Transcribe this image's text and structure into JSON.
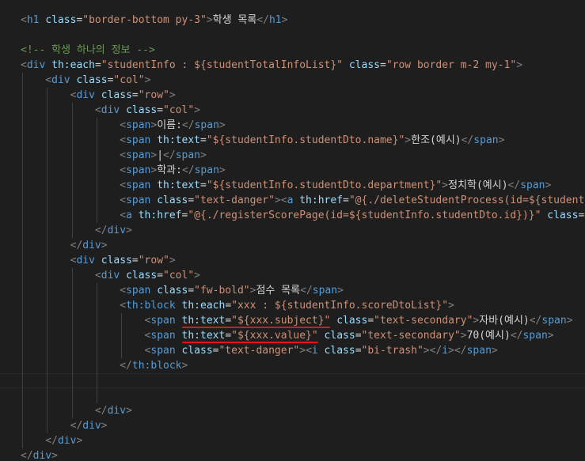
{
  "editor": {
    "theme": {
      "background": "#1e1e1e",
      "tag": "#569cd6",
      "attribute": "#9cdcfe",
      "string": "#ce9178",
      "text": "#d4d4d4",
      "bracket": "#808080",
      "comment": "#6a9955",
      "error_underline": "#e51414"
    },
    "lines": [
      [
        [
          "b",
          "<"
        ],
        [
          "t",
          "h1"
        ],
        [
          "p",
          " "
        ],
        [
          "a",
          "class"
        ],
        [
          "p",
          "="
        ],
        [
          "s",
          "\"border-bottom py-3\""
        ],
        [
          "b",
          ">"
        ],
        [
          "x",
          "학생 목록"
        ],
        [
          "b",
          "</"
        ],
        [
          "t",
          "h1"
        ],
        [
          "b",
          ">"
        ]
      ],
      [],
      [
        [
          "c",
          "<!-- 학생 하나의 정보 -->"
        ]
      ],
      [
        [
          "b",
          "<"
        ],
        [
          "t",
          "div"
        ],
        [
          "p",
          " "
        ],
        [
          "a",
          "th:each"
        ],
        [
          "p",
          "="
        ],
        [
          "s",
          "\"studentInfo : ${studentTotalInfoList}\""
        ],
        [
          "p",
          " "
        ],
        [
          "a",
          "class"
        ],
        [
          "p",
          "="
        ],
        [
          "s",
          "\"row border m-2 my-1\""
        ],
        [
          "b",
          ">"
        ]
      ],
      [
        [
          "p",
          "    "
        ],
        [
          "b",
          "<"
        ],
        [
          "t",
          "div"
        ],
        [
          "p",
          " "
        ],
        [
          "a",
          "class"
        ],
        [
          "p",
          "="
        ],
        [
          "s",
          "\"col\""
        ],
        [
          "b",
          ">"
        ]
      ],
      [
        [
          "p",
          "        "
        ],
        [
          "b",
          "<"
        ],
        [
          "t",
          "div"
        ],
        [
          "p",
          " "
        ],
        [
          "a",
          "class"
        ],
        [
          "p",
          "="
        ],
        [
          "s",
          "\"row\""
        ],
        [
          "b",
          ">"
        ]
      ],
      [
        [
          "p",
          "            "
        ],
        [
          "b",
          "<"
        ],
        [
          "t",
          "div"
        ],
        [
          "p",
          " "
        ],
        [
          "a",
          "class"
        ],
        [
          "p",
          "="
        ],
        [
          "s",
          "\"col\""
        ],
        [
          "b",
          ">"
        ]
      ],
      [
        [
          "p",
          "                "
        ],
        [
          "b",
          "<"
        ],
        [
          "t",
          "span"
        ],
        [
          "b",
          ">"
        ],
        [
          "x",
          "이름:"
        ],
        [
          "b",
          "</"
        ],
        [
          "t",
          "span"
        ],
        [
          "b",
          ">"
        ]
      ],
      [
        [
          "p",
          "                "
        ],
        [
          "b",
          "<"
        ],
        [
          "t",
          "span"
        ],
        [
          "p",
          " "
        ],
        [
          "a",
          "th:text"
        ],
        [
          "p",
          "="
        ],
        [
          "s",
          "\"${studentInfo.studentDto.name}\""
        ],
        [
          "b",
          ">"
        ],
        [
          "x",
          "한조(예시)"
        ],
        [
          "b",
          "</"
        ],
        [
          "t",
          "span"
        ],
        [
          "b",
          ">"
        ]
      ],
      [
        [
          "p",
          "                "
        ],
        [
          "b",
          "<"
        ],
        [
          "t",
          "span"
        ],
        [
          "b",
          ">"
        ],
        [
          "x",
          "|"
        ],
        [
          "b",
          "</"
        ],
        [
          "t",
          "span"
        ],
        [
          "b",
          ">"
        ]
      ],
      [
        [
          "p",
          "                "
        ],
        [
          "b",
          "<"
        ],
        [
          "t",
          "span"
        ],
        [
          "b",
          ">"
        ],
        [
          "x",
          "학과:"
        ],
        [
          "b",
          "</"
        ],
        [
          "t",
          "span"
        ],
        [
          "b",
          ">"
        ]
      ],
      [
        [
          "p",
          "                "
        ],
        [
          "b",
          "<"
        ],
        [
          "t",
          "span"
        ],
        [
          "p",
          " "
        ],
        [
          "a",
          "th:text"
        ],
        [
          "p",
          "="
        ],
        [
          "s",
          "\"${studentInfo.studentDto.department}\""
        ],
        [
          "b",
          ">"
        ],
        [
          "x",
          "정치학(예시)"
        ],
        [
          "b",
          "</"
        ],
        [
          "t",
          "span"
        ],
        [
          "b",
          ">"
        ]
      ],
      [
        [
          "p",
          "                "
        ],
        [
          "b",
          "<"
        ],
        [
          "t",
          "span"
        ],
        [
          "p",
          " "
        ],
        [
          "a",
          "class"
        ],
        [
          "p",
          "="
        ],
        [
          "s",
          "\"text-danger\""
        ],
        [
          "b",
          ">"
        ],
        [
          "b",
          "<"
        ],
        [
          "t",
          "a"
        ],
        [
          "p",
          " "
        ],
        [
          "a",
          "th:href"
        ],
        [
          "p",
          "="
        ],
        [
          "s",
          "\"@{./deleteStudentProcess(id=${studentIn"
        ]
      ],
      [
        [
          "p",
          "                "
        ],
        [
          "b",
          "<"
        ],
        [
          "t",
          "a"
        ],
        [
          "p",
          " "
        ],
        [
          "a",
          "th:href"
        ],
        [
          "p",
          "="
        ],
        [
          "s",
          "\"@{./registerScorePage(id=${studentInfo.studentDto.id})}\""
        ],
        [
          "p",
          " "
        ],
        [
          "a",
          "class"
        ],
        [
          "p",
          "="
        ],
        [
          "s",
          "\"t"
        ]
      ],
      [
        [
          "p",
          "            "
        ],
        [
          "b",
          "</"
        ],
        [
          "t",
          "div"
        ],
        [
          "b",
          ">"
        ]
      ],
      [
        [
          "p",
          "        "
        ],
        [
          "b",
          "</"
        ],
        [
          "t",
          "div"
        ],
        [
          "b",
          ">"
        ]
      ],
      [
        [
          "p",
          "        "
        ],
        [
          "b",
          "<"
        ],
        [
          "t",
          "div"
        ],
        [
          "p",
          " "
        ],
        [
          "a",
          "class"
        ],
        [
          "p",
          "="
        ],
        [
          "s",
          "\"row\""
        ],
        [
          "b",
          ">"
        ]
      ],
      [
        [
          "p",
          "            "
        ],
        [
          "b",
          "<"
        ],
        [
          "t",
          "div"
        ],
        [
          "p",
          " "
        ],
        [
          "a",
          "class"
        ],
        [
          "p",
          "="
        ],
        [
          "s",
          "\"col\""
        ],
        [
          "b",
          ">"
        ]
      ],
      [
        [
          "p",
          "                "
        ],
        [
          "b",
          "<"
        ],
        [
          "t",
          "span"
        ],
        [
          "p",
          " "
        ],
        [
          "a",
          "class"
        ],
        [
          "p",
          "="
        ],
        [
          "s",
          "\"fw-bold\""
        ],
        [
          "b",
          ">"
        ],
        [
          "x",
          "점수 목록"
        ],
        [
          "b",
          "</"
        ],
        [
          "t",
          "span"
        ],
        [
          "b",
          ">"
        ]
      ],
      [
        [
          "p",
          "                "
        ],
        [
          "b",
          "<"
        ],
        [
          "t",
          "th:block"
        ],
        [
          "p",
          " "
        ],
        [
          "a",
          "th:each"
        ],
        [
          "p",
          "="
        ],
        [
          "s",
          "\"xxx : ${studentInfo.scoreDtoList}\""
        ],
        [
          "b",
          ">"
        ]
      ],
      [
        [
          "p",
          "                    "
        ],
        [
          "b",
          "<"
        ],
        [
          "t",
          "span"
        ],
        [
          "p",
          " "
        ],
        [
          "a",
          "th:text"
        ],
        [
          "p",
          "="
        ],
        [
          "s",
          "\"${xxx.subject}\""
        ],
        [
          "p",
          " "
        ],
        [
          "a",
          "class"
        ],
        [
          "p",
          "="
        ],
        [
          "s",
          "\"text-secondary\""
        ],
        [
          "b",
          ">"
        ],
        [
          "x",
          "자바(예시)"
        ],
        [
          "b",
          "</"
        ],
        [
          "t",
          "span"
        ],
        [
          "b",
          ">"
        ]
      ],
      [
        [
          "p",
          "                    "
        ],
        [
          "b",
          "<"
        ],
        [
          "t",
          "span"
        ],
        [
          "p",
          " "
        ],
        [
          "a",
          "th:text"
        ],
        [
          "p",
          "="
        ],
        [
          "s",
          "\"${xxx.value}\""
        ],
        [
          "p",
          " "
        ],
        [
          "a",
          "class"
        ],
        [
          "p",
          "="
        ],
        [
          "s",
          "\"text-secondary\""
        ],
        [
          "b",
          ">"
        ],
        [
          "x",
          "70(예시)"
        ],
        [
          "b",
          "</"
        ],
        [
          "t",
          "span"
        ],
        [
          "b",
          ">"
        ]
      ],
      [
        [
          "p",
          "                    "
        ],
        [
          "b",
          "<"
        ],
        [
          "t",
          "span"
        ],
        [
          "p",
          " "
        ],
        [
          "a",
          "class"
        ],
        [
          "p",
          "="
        ],
        [
          "s",
          "\"text-danger\""
        ],
        [
          "b",
          ">"
        ],
        [
          "b",
          "<"
        ],
        [
          "t",
          "i"
        ],
        [
          "p",
          " "
        ],
        [
          "a",
          "class"
        ],
        [
          "p",
          "="
        ],
        [
          "s",
          "\"bi-trash\""
        ],
        [
          "b",
          ">"
        ],
        [
          "b",
          "</"
        ],
        [
          "t",
          "i"
        ],
        [
          "b",
          ">"
        ],
        [
          "b",
          "</"
        ],
        [
          "t",
          "span"
        ],
        [
          "b",
          ">"
        ]
      ],
      [
        [
          "p",
          "                "
        ],
        [
          "b",
          "</"
        ],
        [
          "t",
          "th:block"
        ],
        [
          "b",
          ">"
        ]
      ],
      [],
      [],
      [
        [
          "p",
          "            "
        ],
        [
          "b",
          "</"
        ],
        [
          "t",
          "div"
        ],
        [
          "b",
          ">"
        ]
      ],
      [
        [
          "p",
          "        "
        ],
        [
          "b",
          "</"
        ],
        [
          "t",
          "div"
        ],
        [
          "b",
          ">"
        ]
      ],
      [
        [
          "p",
          "    "
        ],
        [
          "b",
          "</"
        ],
        [
          "t",
          "div"
        ],
        [
          "b",
          ">"
        ]
      ],
      [
        [
          "b",
          "</"
        ],
        [
          "t",
          "div"
        ],
        [
          "b",
          ">"
        ]
      ]
    ]
  }
}
